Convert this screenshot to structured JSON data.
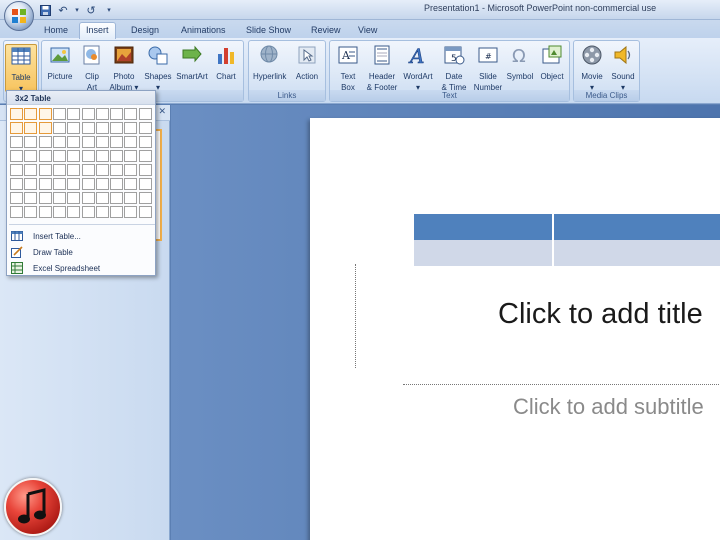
{
  "window": {
    "title": "Presentation1 - Microsoft PowerPoint non-commercial use"
  },
  "tabs": [
    "Home",
    "Insert",
    "Design",
    "Animations",
    "Slide Show",
    "Review",
    "View"
  ],
  "active_tab": "Insert",
  "ribbon": {
    "tables": {
      "buttons": [
        {
          "label": "Table",
          "sublabel": "▾",
          "icon": "table-icon"
        }
      ]
    },
    "illustrations": {
      "label": "Illustrations",
      "visible_label": "ons",
      "buttons": [
        {
          "label": "Picture",
          "sublabel": "",
          "icon": "picture-icon"
        },
        {
          "label": "Clip",
          "sublabel": "Art",
          "icon": "clip-art-icon"
        },
        {
          "label": "Photo",
          "sublabel": "Album ▾",
          "icon": "photo-album-icon"
        },
        {
          "label": "Shapes",
          "sublabel": "▾",
          "icon": "shapes-icon"
        },
        {
          "label": "SmartArt",
          "sublabel": "",
          "icon": "smartart-icon"
        },
        {
          "label": "Chart",
          "sublabel": "",
          "icon": "chart-icon"
        }
      ]
    },
    "links": {
      "label": "Links",
      "buttons": [
        {
          "label": "Hyperlink",
          "sublabel": "",
          "icon": "hyperlink-icon"
        },
        {
          "label": "Action",
          "sublabel": "",
          "icon": "action-icon"
        }
      ]
    },
    "text": {
      "label": "Text",
      "buttons": [
        {
          "label": "Text",
          "sublabel": "Box",
          "icon": "text-box-icon"
        },
        {
          "label": "Header",
          "sublabel": "& Footer",
          "icon": "header-footer-icon"
        },
        {
          "label": "WordArt",
          "sublabel": "▾",
          "icon": "wordart-icon"
        },
        {
          "label": "Date",
          "sublabel": "& Time",
          "icon": "date-time-icon"
        },
        {
          "label": "Slide",
          "sublabel": "Number",
          "icon": "slide-number-icon"
        },
        {
          "label": "Symbol",
          "sublabel": "",
          "icon": "symbol-icon"
        },
        {
          "label": "Object",
          "sublabel": "",
          "icon": "object-icon"
        }
      ]
    },
    "media": {
      "label": "Media Clips",
      "buttons": [
        {
          "label": "Movie",
          "sublabel": "▾",
          "icon": "movie-icon"
        },
        {
          "label": "Sound",
          "sublabel": "▾",
          "icon": "sound-icon"
        }
      ]
    }
  },
  "table_dropdown": {
    "header": "3x2 Table",
    "grid": {
      "columns": 10,
      "rows": 8,
      "selected_columns": 3,
      "selected_rows": 2
    },
    "items": [
      {
        "label": "Insert Table...",
        "icon": "insert-table-icon"
      },
      {
        "label": "Draw Table",
        "icon": "draw-table-icon"
      },
      {
        "label": "Excel Spreadsheet",
        "icon": "excel-spreadsheet-icon"
      }
    ]
  },
  "slide": {
    "title_placeholder": "Click to add title",
    "subtitle_placeholder": "Click to add subtitle"
  },
  "colors": {
    "table_header": "#4f81bd",
    "table_row": "#d0d8e8",
    "grid_selected": "#e59a3a",
    "accent": "#f7c45f"
  }
}
